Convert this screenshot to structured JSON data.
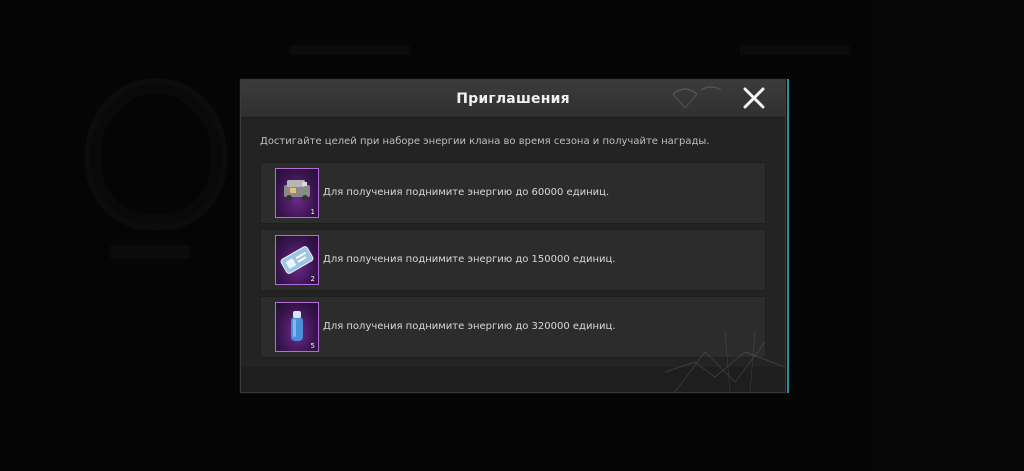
{
  "modal": {
    "title": "Приглашения",
    "description": "Достигайте целей при наборе энергии клана во время сезона и получайте награды.",
    "rewards": [
      {
        "icon": "vehicle-crate-icon",
        "quantity": "1",
        "text": "Для получения поднимите энергию до 60000 единиц."
      },
      {
        "icon": "rename-card-icon",
        "quantity": "2",
        "text": "Для получения поднимите энергию до 150000 единиц."
      },
      {
        "icon": "spray-can-icon",
        "quantity": "5",
        "text": "Для получения поднимите энергию до 320000 единиц."
      }
    ]
  },
  "colors": {
    "modal_bg": "#232323",
    "header_bg": "#333333",
    "row_bg": "#2c2c2c",
    "item_frame": "#b36cd9",
    "item_bg": "#4a1d60"
  }
}
